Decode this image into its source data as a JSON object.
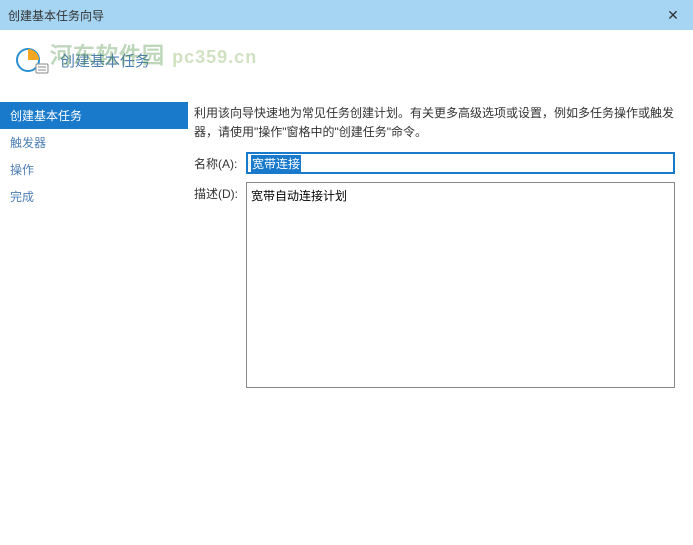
{
  "titlebar": {
    "title": "创建基本任务向导"
  },
  "header": {
    "title": "创建基本任务"
  },
  "watermark": {
    "text": "河东软件园",
    "domain": "pc359.cn"
  },
  "sidebar": {
    "items": [
      {
        "label": "创建基本任务",
        "active": true
      },
      {
        "label": "触发器",
        "active": false
      },
      {
        "label": "操作",
        "active": false
      },
      {
        "label": "完成",
        "active": false
      }
    ]
  },
  "main": {
    "instruction": "利用该向导快速地为常见任务创建计划。有关更多高级选项或设置，例如多任务操作或触发器，请使用\"操作\"窗格中的\"创建任务\"命令。",
    "name_label": "名称(A):",
    "name_value": "宽带连接",
    "desc_label": "描述(D):",
    "desc_value": "宽带自动连接计划"
  }
}
